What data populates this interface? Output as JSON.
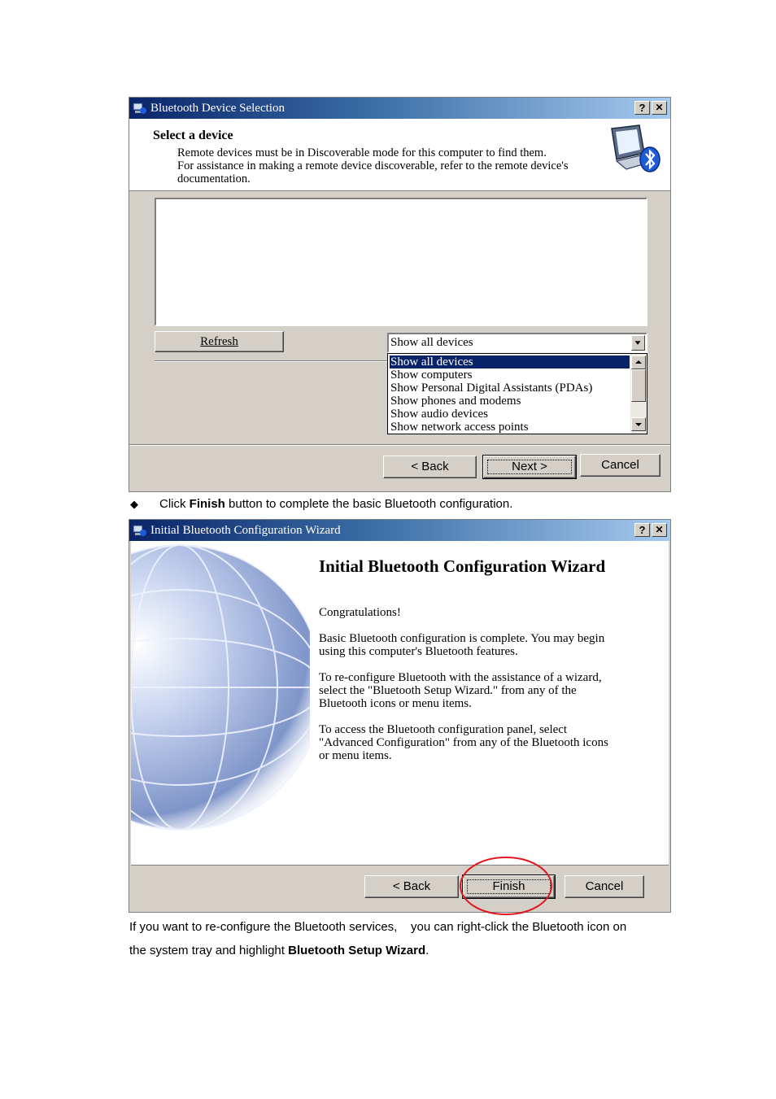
{
  "device_selection_dialog": {
    "title": "Bluetooth Device Selection",
    "help_button": "?",
    "close_button": "✕",
    "header_title": "Select a device",
    "header_line1": "Remote devices must be in Discoverable mode for this computer to find them.",
    "header_line2": "For assistance in making a remote device discoverable, refer to the remote device's",
    "header_line3": "documentation.",
    "refresh_label": "Refresh",
    "filter_selected": "Show all devices",
    "filter_options": [
      "Show all devices",
      "Show computers",
      "Show Personal Digital Assistants (PDAs)",
      "Show phones and modems",
      "Show audio devices",
      "Show network access points"
    ],
    "back_label": "< Back",
    "next_label": "Next >",
    "cancel_label": "Cancel"
  },
  "instruction": {
    "bullet": "◆",
    "prefix": "Click ",
    "bold": "Finish",
    "suffix": " button to complete the basic Bluetooth configuration."
  },
  "wizard_dialog": {
    "title": "Initial Bluetooth Configuration Wizard",
    "help_button": "?",
    "close_button": "✕",
    "heading": "Initial Bluetooth Configuration Wizard",
    "congrats": "Congratulations!",
    "p1_line1": "Basic Bluetooth configuration is complete.  You may begin",
    "p1_line2": "using this computer's Bluetooth features.",
    "p2_line1": "To re-configure Bluetooth with the assistance of a wizard,",
    "p2_line2": "select the \"Bluetooth Setup Wizard.\" from any of the",
    "p2_line3": "Bluetooth icons or menu items.",
    "p3_line1": "To access the Bluetooth configuration panel, select",
    "p3_line2": "\"Advanced Configuration\" from any of the Bluetooth icons",
    "p3_line3": "or menu items.",
    "back_label": "< Back",
    "finish_label": "Finish",
    "cancel_label": "Cancel"
  },
  "footer": {
    "line1": "If you want to re-configure the Bluetooth services,    you can right-click the Bluetooth icon on",
    "line2_prefix": "the system tray and highlight ",
    "line2_bold": "Bluetooth Setup Wizard",
    "line2_suffix": "."
  },
  "colors": {
    "titlebar_start": "#0a246a",
    "titlebar_end": "#a6caf0",
    "dialog_face": "#d4d0c8",
    "selection": "#0a246a",
    "highlight_circle": "#e0161e"
  }
}
